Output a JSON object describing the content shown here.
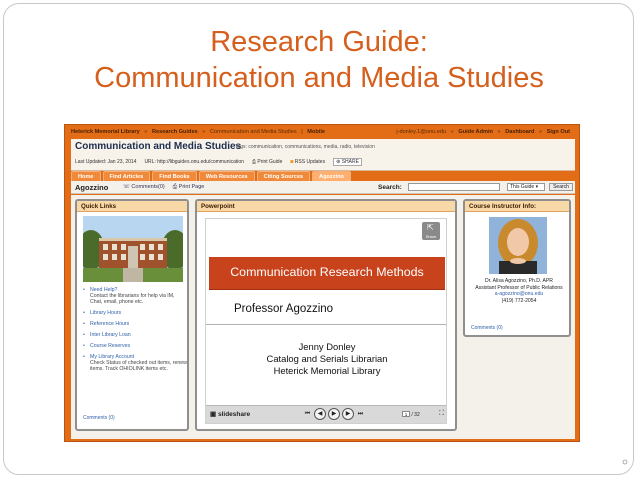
{
  "slide": {
    "title_line1": "Research Guide:",
    "title_line2": "Communication and Media Studies"
  },
  "topnav": {
    "breadcrumb": [
      "Heterick Memorial Library",
      "»",
      "Research Guides",
      "»",
      "Communication and Media Studies",
      "|",
      "Mobile"
    ],
    "account": [
      "j-donley.1@onu.edu",
      "»",
      "Guide Admin",
      "»",
      "Dashboard",
      "»",
      "Sign Out"
    ]
  },
  "header": {
    "guide_title": "Communication and Media Studies",
    "tags": "Tags: communication, communications, media, radio, television",
    "last_updated": "Last Updated: Jan 23, 2014",
    "url": "URL: http://libguides.onu.edu/communication",
    "print_guide": "Print Guide",
    "rss": "RSS Updates",
    "share": "SHARE"
  },
  "tabs": [
    {
      "label": "Home",
      "active": false
    },
    {
      "label": "Find Articles",
      "active": false
    },
    {
      "label": "Find Books",
      "active": false
    },
    {
      "label": "Web Resources",
      "active": false
    },
    {
      "label": "Citing Sources",
      "active": false
    },
    {
      "label": "Agozzino",
      "active": true
    }
  ],
  "subbar": {
    "page_name": "Agozzino",
    "comments": "Comments(0)",
    "print_page": "Print Page",
    "search_label": "Search:",
    "search_value": "",
    "scope": "This Guide",
    "search_button": "Search"
  },
  "quick_links": {
    "header": "Quick Links",
    "items": [
      {
        "label": "Need Help?",
        "desc": "Contact the librarians for help via IM, Chat, email, phone etc."
      },
      {
        "label": "Library Hours",
        "desc": ""
      },
      {
        "label": "Reference Hours",
        "desc": ""
      },
      {
        "label": "Inter Library Loan",
        "desc": ""
      },
      {
        "label": "Course Reserves",
        "desc": ""
      },
      {
        "label": "My Library Account",
        "desc": "Check Status of checked out items, renew items. Track OHIOLINK items etc."
      }
    ],
    "comments": "Comments (0)"
  },
  "powerpoint": {
    "header": "Powerpoint",
    "share": "Share",
    "banner": "Communication Research Methods",
    "professor": "Professor Agozzino",
    "speaker_lines": [
      "Jenny Donley",
      "Catalog and Serials Librarian",
      "Heterick Memorial Library"
    ],
    "slideshare_logo": "slideshare",
    "current_page": "1",
    "total_pages": "/ 32"
  },
  "instructor": {
    "header": "Course Instructor Info:",
    "lines": [
      "Dr. Alisa Agozzino, Ph.D. APR",
      "Assistant Professor of Public Relations"
    ],
    "email": "a-agozzino@onu.edu",
    "phone": "(419) 772-2054",
    "comments": "Comments (0)"
  },
  "colors": {
    "title_orange": "#d55f1d",
    "frame_orange": "#e36c16",
    "banner_red": "#c8421c",
    "link_blue": "#2f5fa8"
  }
}
